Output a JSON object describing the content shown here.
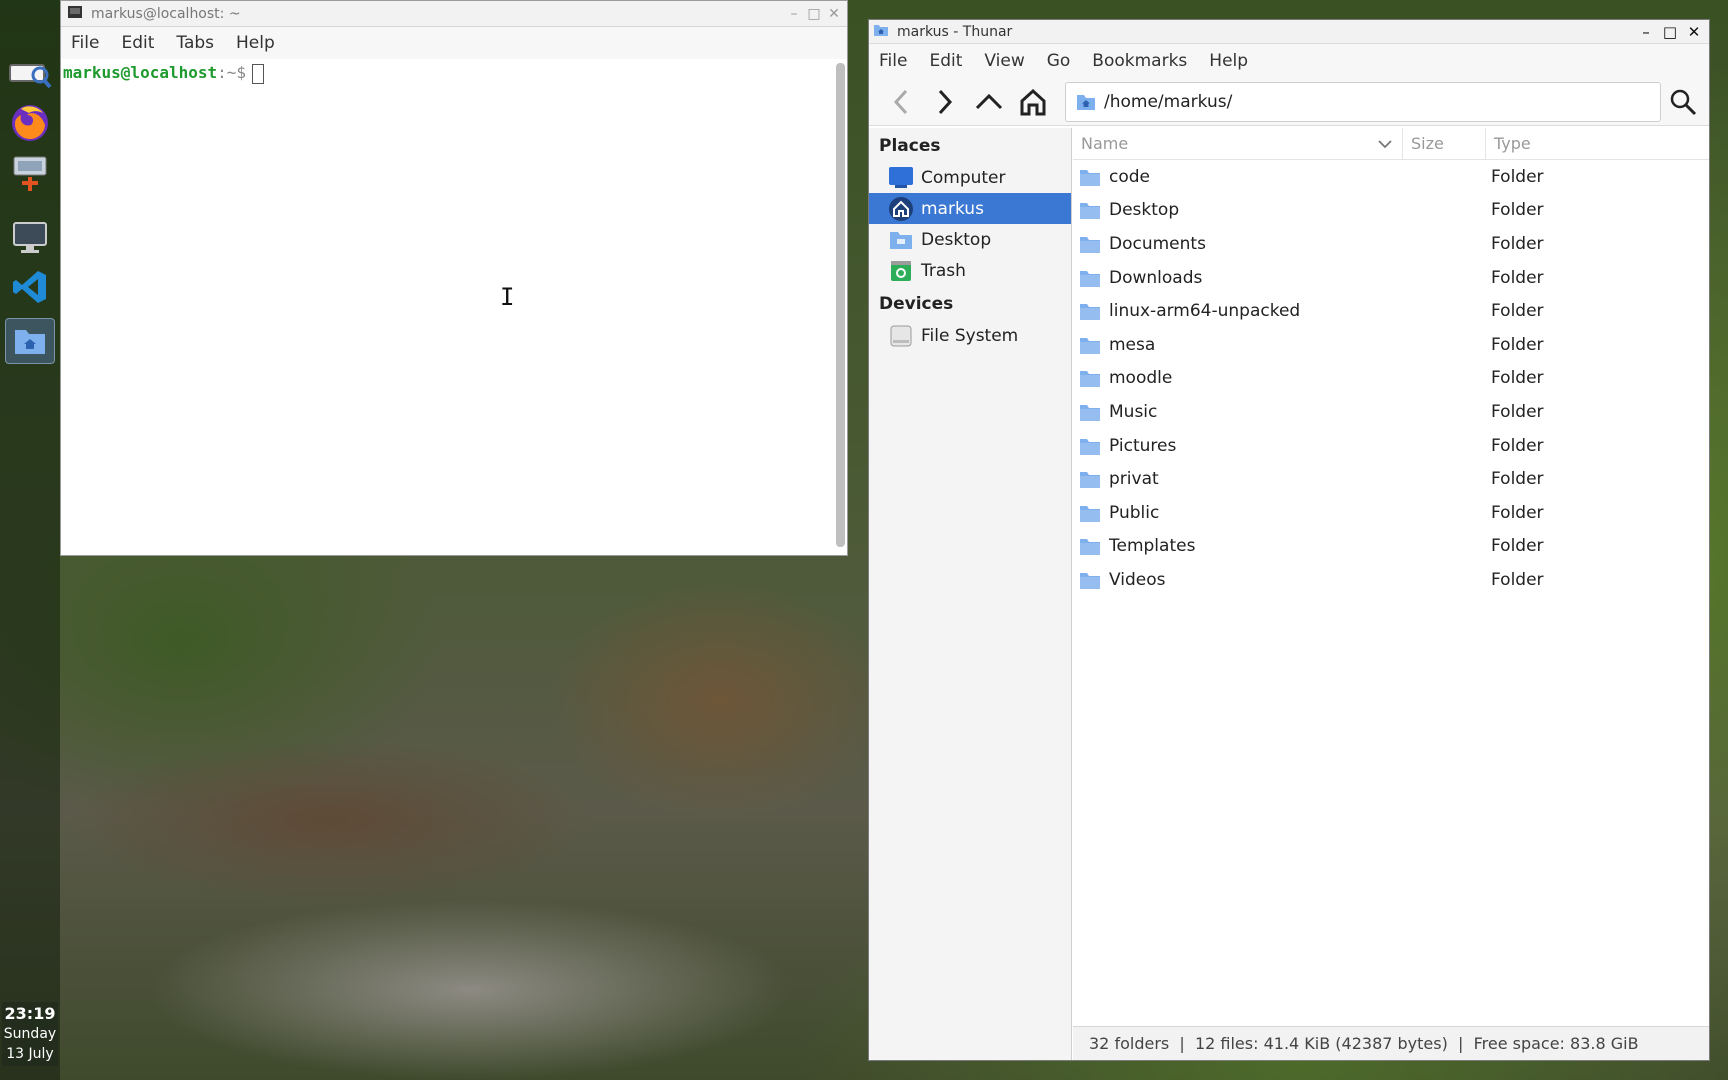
{
  "desktop": {
    "clock": {
      "time": "23:19",
      "day": "Sunday",
      "date": "13 July"
    },
    "dock_icons": [
      "search-app-icon",
      "firefox-icon",
      "screenshot-app-icon",
      "monitor-icon",
      "vscode-icon",
      "file-manager-icon"
    ]
  },
  "terminal": {
    "title": "markus@localhost: ~",
    "menu": [
      "File",
      "Edit",
      "Tabs",
      "Help"
    ],
    "prompt_user": "markus@localhost",
    "prompt_sep": ":~$"
  },
  "thunar": {
    "title": "markus - Thunar",
    "menu": [
      "File",
      "Edit",
      "View",
      "Go",
      "Bookmarks",
      "Help"
    ],
    "path": "/home/markus/",
    "sidebar": {
      "places_heading": "Places",
      "places": [
        {
          "label": "Computer",
          "icon": "computer-icon"
        },
        {
          "label": "markus",
          "icon": "home-icon",
          "selected": true
        },
        {
          "label": "Desktop",
          "icon": "desktop-folder-icon"
        },
        {
          "label": "Trash",
          "icon": "trash-icon"
        }
      ],
      "devices_heading": "Devices",
      "devices": [
        {
          "label": "File System",
          "icon": "drive-icon"
        }
      ]
    },
    "columns": {
      "name": "Name",
      "size": "Size",
      "type": "Type"
    },
    "files": [
      {
        "name": "code",
        "type": "Folder"
      },
      {
        "name": "Desktop",
        "type": "Folder"
      },
      {
        "name": "Documents",
        "type": "Folder"
      },
      {
        "name": "Downloads",
        "type": "Folder"
      },
      {
        "name": "linux-arm64-unpacked",
        "type": "Folder"
      },
      {
        "name": "mesa",
        "type": "Folder"
      },
      {
        "name": "moodle",
        "type": "Folder"
      },
      {
        "name": "Music",
        "type": "Folder"
      },
      {
        "name": "Pictures",
        "type": "Folder"
      },
      {
        "name": "privat",
        "type": "Folder"
      },
      {
        "name": "Public",
        "type": "Folder"
      },
      {
        "name": "Templates",
        "type": "Folder"
      },
      {
        "name": "Videos",
        "type": "Folder"
      }
    ],
    "status": "32 folders  |  12 files: 41.4 KiB (42387 bytes)  |  Free space: 83.8 GiB"
  },
  "colors": {
    "selection": "#3b78d4",
    "folder": "#7fb0ee",
    "prompt_green": "#1e9a2e"
  }
}
